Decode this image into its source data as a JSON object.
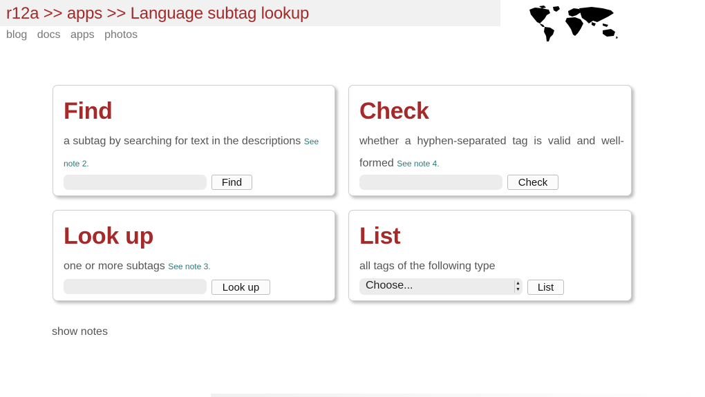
{
  "header": {
    "breadcrumb": [
      "r12a",
      "apps",
      "Language subtag lookup"
    ],
    "separator": ">>",
    "nav": [
      "blog",
      "docs",
      "apps",
      "photos"
    ],
    "map_icon": "world-map-icon"
  },
  "cards": {
    "find": {
      "title": "Find",
      "desc": "a subtag by searching for text in the descriptions",
      "note": "See note 2.",
      "input_value": "",
      "button": "Find"
    },
    "check": {
      "title": "Check",
      "desc": "whether a hyphen-separated tag is valid and well-formed",
      "note": "See note 4.",
      "input_value": "",
      "button": "Check"
    },
    "lookup": {
      "title": "Look up",
      "desc": "one or more subtags",
      "note": "See note 3.",
      "input_value": "",
      "button": "Look up"
    },
    "list": {
      "title": "List",
      "desc": "all tags of the following type",
      "select_value": "Choose...",
      "button": "List"
    }
  },
  "show_notes": "show notes",
  "colors": {
    "accent": "#a52a2a",
    "note_link": "#2a7a7a",
    "header_bg": "#f1f1f1"
  }
}
